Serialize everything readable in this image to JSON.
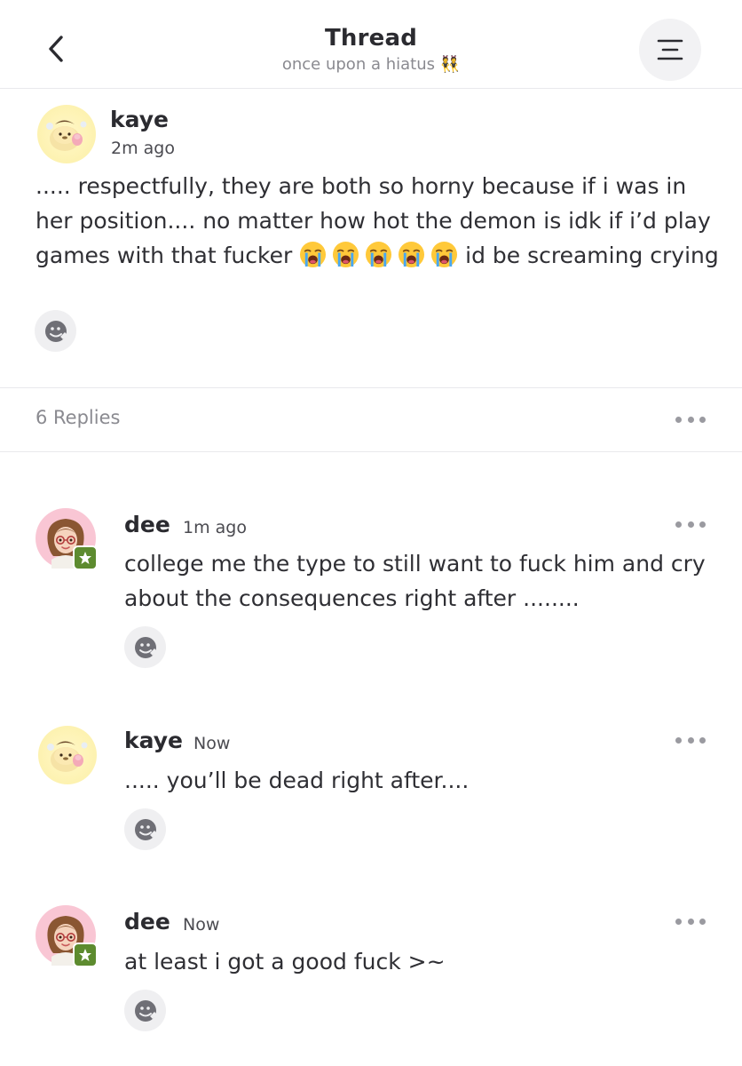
{
  "header": {
    "title": "Thread",
    "subtitle": "once upon a hiatus 👯",
    "back_icon": "chevron-left-icon",
    "menu_icon": "menu-icon"
  },
  "post": {
    "author": "kaye",
    "time": "2m ago",
    "text_before_emoji": "..... respectfully, they are both so horny because if i was in her position.... no matter how hot the demon is idk if i’d play games with that fucker ",
    "emoji_name": "loudly-crying-face-emoji",
    "emoji_count": 5,
    "text_after_emoji": " id be screaming crying",
    "react_icon": "add-reaction-icon"
  },
  "replies_bar": {
    "label": "6 Replies",
    "more_icon": "more-dots-icon"
  },
  "replies": [
    {
      "author": "dee",
      "time": "1m ago",
      "text": "college me the type to still want to fuck him and cry about the consequences right after ........",
      "badge_icon": "star-badge-icon"
    },
    {
      "author": "kaye",
      "time": "Now",
      "text": "..... you’ll be dead right after...."
    },
    {
      "author": "dee",
      "time": "Now",
      "text": "at least i got a good fuck >~",
      "badge_icon": "star-badge-icon"
    }
  ],
  "colors": {
    "text": "#2b2b30",
    "muted": "#8a8a90",
    "badge_green": "#5d8b2f",
    "button_bg": "#efeff1"
  }
}
